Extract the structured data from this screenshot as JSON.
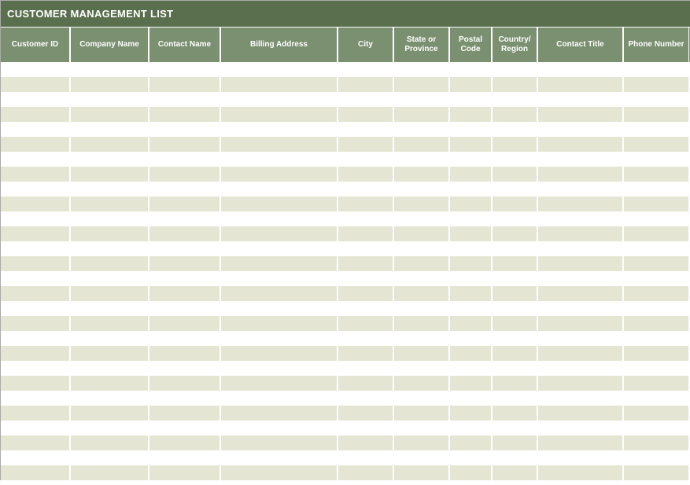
{
  "title": "CUSTOMER MANAGEMENT LIST",
  "columns": [
    "Customer ID",
    "Company Name",
    "Contact Name",
    "Billing Address",
    "City",
    "State or Province",
    "Postal Code",
    "Country/ Region",
    "Contact Title",
    "Phone Number"
  ],
  "rows": [
    [
      "",
      "",
      "",
      "",
      "",
      "",
      "",
      "",
      "",
      ""
    ],
    [
      "",
      "",
      "",
      "",
      "",
      "",
      "",
      "",
      "",
      ""
    ],
    [
      "",
      "",
      "",
      "",
      "",
      "",
      "",
      "",
      "",
      ""
    ],
    [
      "",
      "",
      "",
      "",
      "",
      "",
      "",
      "",
      "",
      ""
    ],
    [
      "",
      "",
      "",
      "",
      "",
      "",
      "",
      "",
      "",
      ""
    ],
    [
      "",
      "",
      "",
      "",
      "",
      "",
      "",
      "",
      "",
      ""
    ],
    [
      "",
      "",
      "",
      "",
      "",
      "",
      "",
      "",
      "",
      ""
    ],
    [
      "",
      "",
      "",
      "",
      "",
      "",
      "",
      "",
      "",
      ""
    ],
    [
      "",
      "",
      "",
      "",
      "",
      "",
      "",
      "",
      "",
      ""
    ],
    [
      "",
      "",
      "",
      "",
      "",
      "",
      "",
      "",
      "",
      ""
    ],
    [
      "",
      "",
      "",
      "",
      "",
      "",
      "",
      "",
      "",
      ""
    ],
    [
      "",
      "",
      "",
      "",
      "",
      "",
      "",
      "",
      "",
      ""
    ],
    [
      "",
      "",
      "",
      "",
      "",
      "",
      "",
      "",
      "",
      ""
    ],
    [
      "",
      "",
      "",
      "",
      "",
      "",
      "",
      "",
      "",
      ""
    ],
    [
      "",
      "",
      "",
      "",
      "",
      "",
      "",
      "",
      "",
      ""
    ],
    [
      "",
      "",
      "",
      "",
      "",
      "",
      "",
      "",
      "",
      ""
    ],
    [
      "",
      "",
      "",
      "",
      "",
      "",
      "",
      "",
      "",
      ""
    ],
    [
      "",
      "",
      "",
      "",
      "",
      "",
      "",
      "",
      "",
      ""
    ],
    [
      "",
      "",
      "",
      "",
      "",
      "",
      "",
      "",
      "",
      ""
    ],
    [
      "",
      "",
      "",
      "",
      "",
      "",
      "",
      "",
      "",
      ""
    ],
    [
      "",
      "",
      "",
      "",
      "",
      "",
      "",
      "",
      "",
      ""
    ],
    [
      "",
      "",
      "",
      "",
      "",
      "",
      "",
      "",
      "",
      ""
    ],
    [
      "",
      "",
      "",
      "",
      "",
      "",
      "",
      "",
      "",
      ""
    ],
    [
      "",
      "",
      "",
      "",
      "",
      "",
      "",
      "",
      "",
      ""
    ],
    [
      "",
      "",
      "",
      "",
      "",
      "",
      "",
      "",
      "",
      ""
    ],
    [
      "",
      "",
      "",
      "",
      "",
      "",
      "",
      "",
      "",
      ""
    ],
    [
      "",
      "",
      "",
      "",
      "",
      "",
      "",
      "",
      "",
      ""
    ],
    [
      "",
      "",
      "",
      "",
      "",
      "",
      "",
      "",
      "",
      ""
    ]
  ]
}
